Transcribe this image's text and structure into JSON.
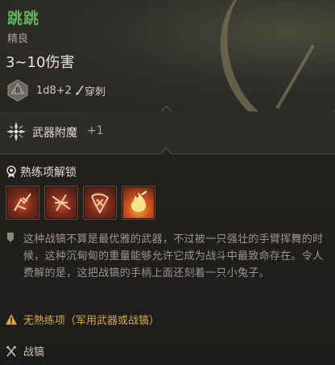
{
  "item": {
    "name": "跳跳",
    "rarity": "精良",
    "damage": "3~10伤害",
    "dice_label": "8",
    "dice_formula": "1d8+2",
    "damage_type": "穿刺",
    "name_color": "#5fb35f"
  },
  "enchant": {
    "label": "武器附魔",
    "value": "+1",
    "icon": "enchant-icon"
  },
  "proficiency": {
    "title": "熟练项解锁",
    "skills": [
      {
        "icon": "skill-slash-icon"
      },
      {
        "icon": "skill-strike-icon"
      },
      {
        "icon": "skill-cleave-icon"
      },
      {
        "icon": "skill-fire-icon"
      }
    ]
  },
  "description": "这种战镐不算是最优雅的武器，不过被一只强壮的手臂挥舞的时候，这种沉甸甸的重量能够允许它成为战斗中最致命存在。令人费解的是，这把战镐的手柄上面还刻着一只小兔子。",
  "warning": {
    "text": "无熟练项（军用武器或战镐）",
    "color": "#d6a84a"
  },
  "weapon_type": "战镐"
}
